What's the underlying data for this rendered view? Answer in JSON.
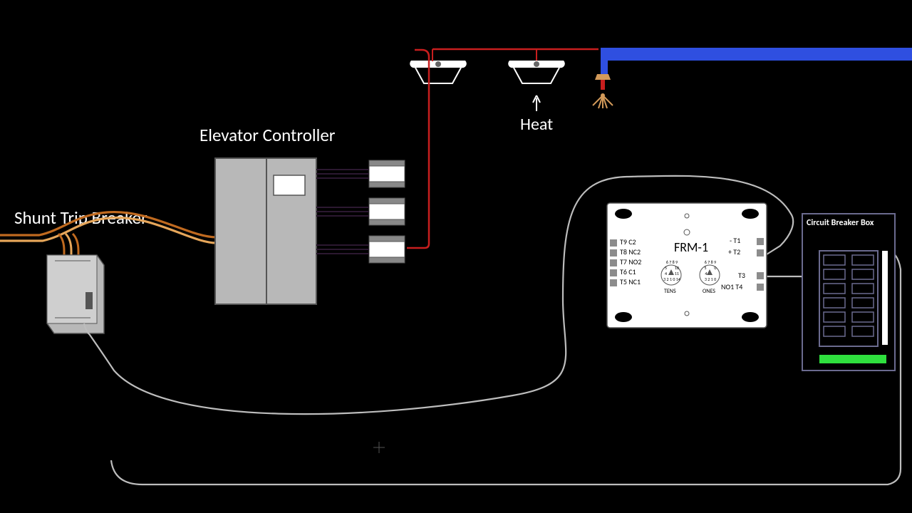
{
  "labels": {
    "shunt": "Shunt Trip Breaker",
    "elevator": "Elevator Controller",
    "heat": "Heat",
    "cbb": "Circuit Breaker Box",
    "frm": "FRM-1",
    "tens": "TENS",
    "ones": "ONES"
  },
  "frm_terminals_left": {
    "t9": "T9",
    "c2": "C2",
    "t8": "T8",
    "nc2": "NC2",
    "t7": "T7",
    "no2": "NO2",
    "t6": "T6",
    "c1": "C1",
    "t5": "T5",
    "nc1": "NC1"
  },
  "frm_terminals_right": {
    "minus": "-",
    "t1": "T1",
    "plus": "+",
    "t2": "T2",
    "t3": "T3",
    "no1": "NO1",
    "t4": "T4"
  },
  "colors": {
    "red": "#c81e1e",
    "orange_d": "#c06a1f",
    "orange_l": "#e6a65a",
    "blue": "#2f4fe0",
    "green": "#2fe03e",
    "grey_panel": "#b8b8b8",
    "grey_dark": "#8c8c8c",
    "wire_grey": "#bdbdbd"
  }
}
